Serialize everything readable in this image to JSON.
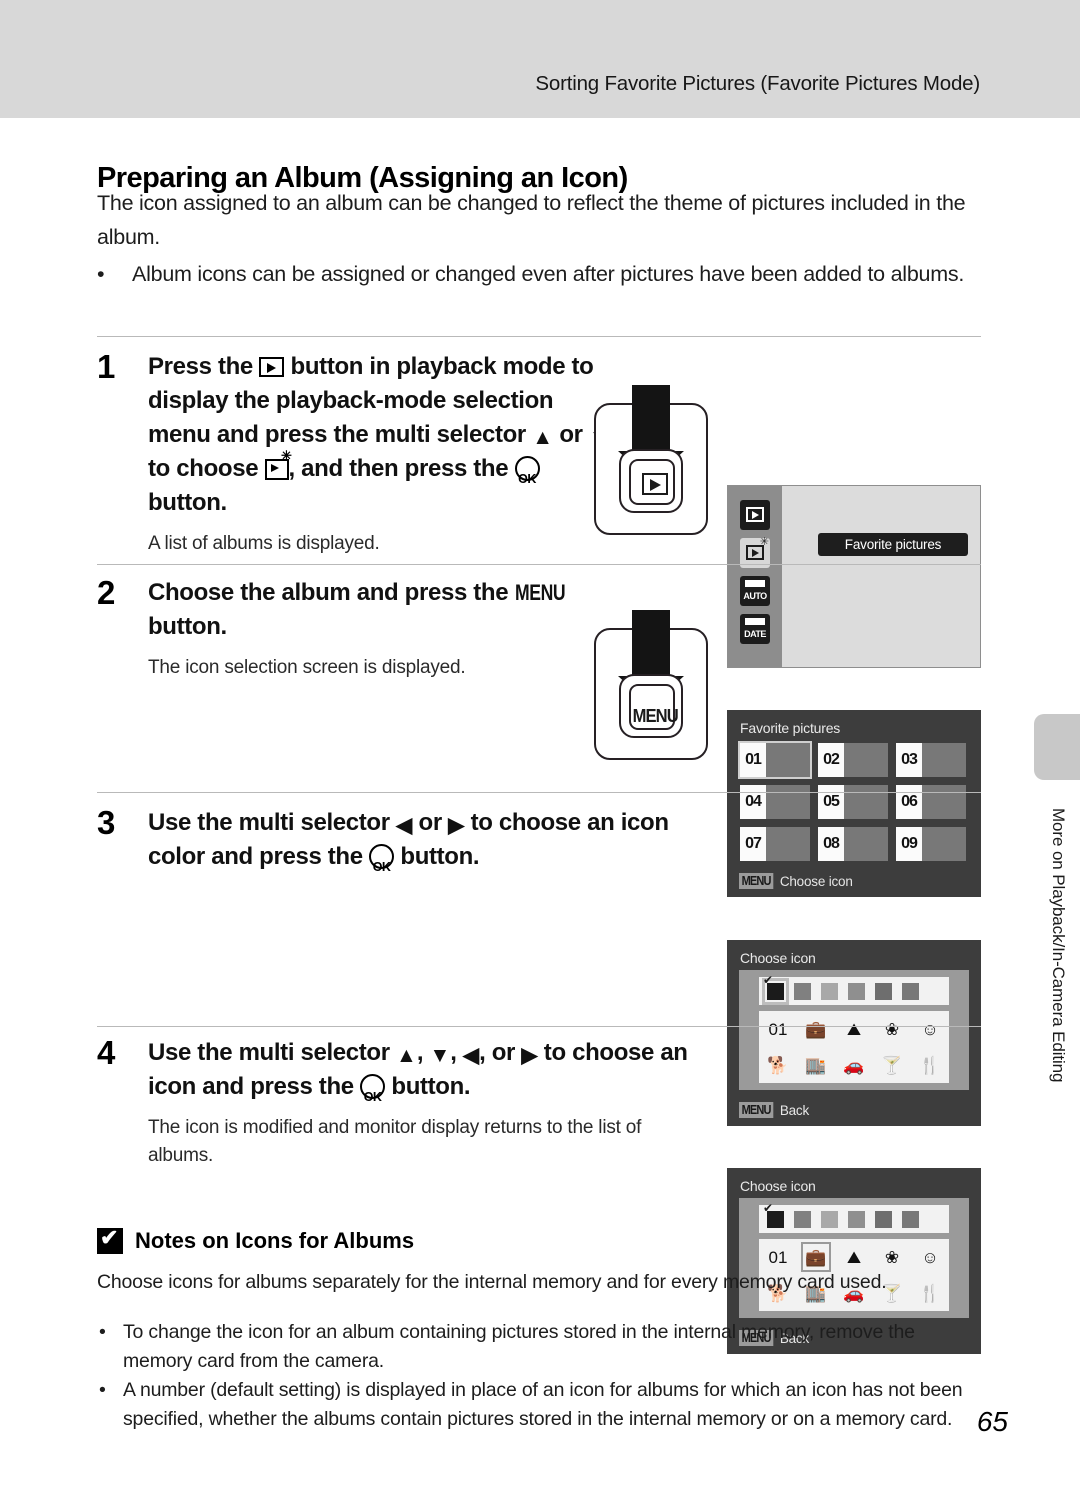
{
  "header": {
    "running_title": "Sorting Favorite Pictures (Favorite Pictures Mode)"
  },
  "page": {
    "title": "Preparing an Album (Assigning an Icon)",
    "intro": "The icon assigned to an album can be changed to reflect the theme of pictures included in the album.",
    "intro_bullet": "Album icons can be assigned or changed even after pictures have been added to albums.",
    "bullet_mark": "•",
    "number": "65",
    "side_tab_text": "More on Playback/In-Camera Editing"
  },
  "steps": [
    {
      "number": "1",
      "text_1": "Press the ",
      "text_2": " button in playback mode to display the playback-mode selection menu and press the multi selector ",
      "up": "▲",
      "or": " or ",
      "down": "▼",
      "text_3": " to choose ",
      "text_4": ", and then press the ",
      "text_5": " button.",
      "note": "A list of albums is displayed."
    },
    {
      "number": "2",
      "text_1": "Choose the album and press the ",
      "menu": "MENU",
      "text_2": " button.",
      "note": "The icon selection screen is displayed."
    },
    {
      "number": "3",
      "text_1": "Use the multi selector ",
      "left": "◀",
      "or": " or ",
      "right": "▶",
      "text_2": " to choose an icon color and press the ",
      "text_3": " button."
    },
    {
      "number": "4",
      "text_1": "Use the multi selector ",
      "up": "▲",
      "sep1": ", ",
      "down": "▼",
      "sep2": ", ",
      "left": "◀",
      "sep3": ", or ",
      "right": "▶",
      "text_2": " to choose an icon and press the ",
      "text_3": " button.",
      "note": "The icon is modified and monitor display returns to the list of albums."
    }
  ],
  "button_illustrations": [
    {
      "key_label": "",
      "icon": "playback-icon"
    },
    {
      "key_label": "MENU",
      "icon": "menu-text"
    }
  ],
  "screens": {
    "playback_mode_menu": {
      "highlight_label": "Favorite pictures",
      "mode_icons": [
        {
          "name": "playback-mode-icon",
          "label": "",
          "selected": false
        },
        {
          "name": "favorite-pictures-mode-icon",
          "label": "",
          "selected": true
        },
        {
          "name": "auto-sort-mode-icon",
          "label": "AUTO",
          "selected": false
        },
        {
          "name": "list-by-date-mode-icon",
          "label": "DATE",
          "selected": false
        }
      ]
    },
    "album_list": {
      "title": "Favorite pictures",
      "menu_chip": "MENU",
      "footer_label": "Choose icon",
      "albums": [
        {
          "number": "01",
          "selected": true
        },
        {
          "number": "02",
          "selected": false
        },
        {
          "number": "03",
          "selected": false
        },
        {
          "number": "04",
          "selected": false
        },
        {
          "number": "05",
          "selected": false
        },
        {
          "number": "06",
          "selected": false
        },
        {
          "number": "07",
          "selected": false
        },
        {
          "number": "08",
          "selected": false
        },
        {
          "number": "09",
          "selected": false
        }
      ]
    },
    "choose_icon_color": {
      "title": "Choose icon",
      "menu_chip": "MENU",
      "footer_label": "Back",
      "swatches": [
        {
          "color": "#1b1b1b",
          "selected": true
        },
        {
          "color": "#808080",
          "selected": false
        },
        {
          "color": "#a8a8a8",
          "selected": false
        },
        {
          "color": "#8f8f8f",
          "selected": false
        },
        {
          "color": "#6e6e6e",
          "selected": false
        },
        {
          "color": "#787878",
          "selected": false
        }
      ],
      "icons": [
        {
          "name": "number-icon",
          "glyph": "01",
          "selected": false
        },
        {
          "name": "suitcase-icon",
          "glyph": "💼",
          "selected": false
        },
        {
          "name": "mountain-icon",
          "glyph": "⛰",
          "selected": false
        },
        {
          "name": "flower-icon",
          "glyph": "❀",
          "selected": false
        },
        {
          "name": "face-icon",
          "glyph": "☺",
          "selected": false
        },
        {
          "name": "dog-icon",
          "glyph": "🐕",
          "selected": false
        },
        {
          "name": "buildings-icon",
          "glyph": "🏬",
          "selected": false
        },
        {
          "name": "car-icon",
          "glyph": "🚗",
          "selected": false
        },
        {
          "name": "cocktail-icon",
          "glyph": "🍸",
          "selected": false
        },
        {
          "name": "cutlery-icon",
          "glyph": "🍴",
          "selected": false
        }
      ]
    },
    "choose_icon_selected": {
      "title": "Choose icon",
      "menu_chip": "MENU",
      "footer_label": "Back",
      "selected_icon_index": 1
    }
  },
  "notes": {
    "heading": "Notes on Icons for Albums",
    "intro": "Choose icons for albums separately for the internal memory and for every memory card used.",
    "bullets": [
      "To change the icon for an album containing pictures stored in the internal memory, remove the memory card from the camera.",
      "A number (default setting) is displayed in place of an icon for albums for which an icon has not been specified, whether the albums contain pictures stored in the internal memory or on a memory card."
    ],
    "bullet_mark": "•"
  }
}
